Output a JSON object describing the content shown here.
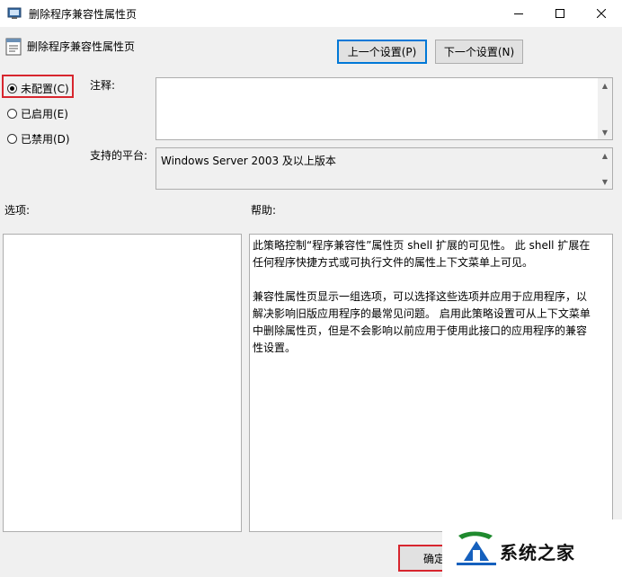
{
  "window": {
    "title": "删除程序兼容性属性页",
    "minimize_icon": "minimize-icon",
    "maximize_icon": "maximize-icon",
    "close_icon": "close-icon"
  },
  "header": {
    "policy_title": "删除程序兼容性属性页",
    "prev_button": "上一个设置(P)",
    "next_button": "下一个设置(N)"
  },
  "state": {
    "options": [
      {
        "label": "未配置(C)",
        "checked": true
      },
      {
        "label": "已启用(E)",
        "checked": false
      },
      {
        "label": "已禁用(D)",
        "checked": false
      }
    ],
    "highlight_color": "#d7262e"
  },
  "fields": {
    "comment_label": "注释:",
    "comment_value": "",
    "platform_label": "支持的平台:",
    "platform_value": "Windows Server 2003 及以上版本"
  },
  "panels": {
    "options_label": "选项:",
    "help_label": "帮助:",
    "help_paragraphs": [
      "此策略控制“程序兼容性”属性页 shell 扩展的可见性。 此 shell 扩展在任何程序快捷方式或可执行文件的属性上下文菜单上可见。",
      "兼容性属性页显示一组选项，可以选择这些选项并应用于应用程序，以解决影响旧版应用程序的最常见问题。 启用此策略设置可从上下文菜单中删除属性页，但是不会影响以前应用于使用此接口的应用程序的兼容性设置。"
    ]
  },
  "footer": {
    "ok_button": "确定",
    "watermark_text": "系统之家"
  }
}
